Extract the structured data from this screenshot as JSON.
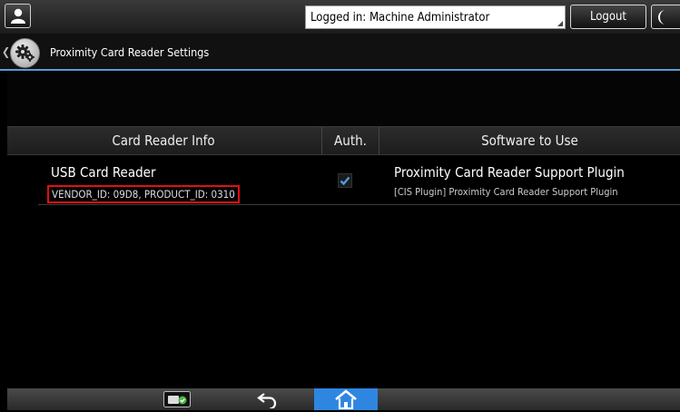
{
  "header": {
    "login_text": "Logged in: Machine Administrator",
    "logout_label": "Logout",
    "user_icon": "user-icon",
    "moon_icon": "moon-icon"
  },
  "titlebar": {
    "title": "Proximity Card Reader Settings",
    "icon": "gear-icon"
  },
  "table": {
    "columns": [
      "Card Reader Info",
      "Auth.",
      "Software to Use"
    ],
    "rows": [
      {
        "reader_name": "USB Card Reader",
        "reader_ids": "VENDOR_ID: 09D8, PRODUCT_ID: 0310",
        "auth_checked": true,
        "software_name": "Proximity Card Reader Support Plugin",
        "software_sub": "[CIS Plugin] Proximity Card Reader Support Plugin"
      }
    ]
  },
  "bottombar": {
    "icons": [
      "sd-card-icon",
      "back-arrow-icon",
      "home-icon"
    ]
  },
  "colors": {
    "accent": "#2f86e0",
    "title_underline": "#5b9bd5",
    "highlight_box": "#e01010"
  }
}
